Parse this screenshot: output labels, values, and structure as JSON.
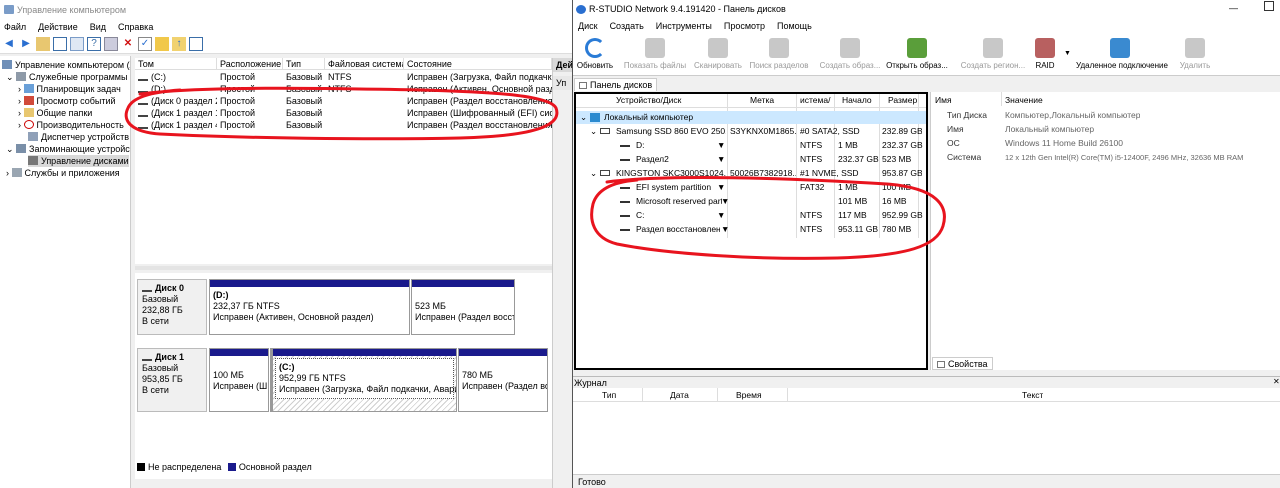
{
  "mmc": {
    "title": "Управление компьютером",
    "menu": [
      "Файл",
      "Действие",
      "Вид",
      "Справка"
    ],
    "tree": [
      {
        "label": "Управление компьютером (л",
        "icon": "computer-icon"
      },
      {
        "label": "Служебные программы",
        "icon": "tools-icon"
      },
      {
        "label": "Планировщик задач",
        "icon": "scheduler-icon"
      },
      {
        "label": "Просмотр событий",
        "icon": "event-viewer-icon"
      },
      {
        "label": "Общие папки",
        "icon": "shared-folder-icon"
      },
      {
        "label": "Производительность",
        "icon": "performance-icon"
      },
      {
        "label": "Диспетчер устройств",
        "icon": "device-manager-icon"
      },
      {
        "label": "Запоминающие устройст",
        "icon": "storage-icon"
      },
      {
        "label": "Управление дисками",
        "icon": "disk-management-icon"
      },
      {
        "label": "Службы и приложения",
        "icon": "services-icon"
      }
    ],
    "volume_columns": [
      "Том",
      "Расположение",
      "Тип",
      "Файловая система",
      "Состояние"
    ],
    "volumes": [
      [
        "(C:)",
        "Простой",
        "Базовый",
        "NTFS",
        "Исправен (Загрузка, Файл подкачки, Ава"
      ],
      [
        "(D:)",
        "Простой",
        "Базовый",
        "NTFS",
        "Исправен (Активен, Основной раздел)"
      ],
      [
        "(Диск 0 раздел 2)",
        "Простой",
        "Базовый",
        "",
        "Исправен (Раздел восстановления)"
      ],
      [
        "(Диск 1 раздел 1)",
        "Простой",
        "Базовый",
        "",
        "Исправен (Шифрованный (EFI) систе"
      ],
      [
        "(Диск 1 раздел 4)",
        "Простой",
        "Базовый",
        "",
        "Исправен (Раздел восстановления)"
      ]
    ],
    "actions_label": "Дей",
    "actions_sub": "Уп",
    "disks": [
      {
        "name": "Диск 0",
        "type": "Базовый",
        "size": "232,88 ГБ",
        "status": "В сети",
        "parts": [
          {
            "title": "(D:)",
            "line1": "232,37 ГБ NTFS",
            "line2": "Исправен (Активен, Основной раздел)"
          },
          {
            "title": "",
            "line1": "523 МБ",
            "line2": "Исправен (Раздел восст"
          }
        ]
      },
      {
        "name": "Диск 1",
        "type": "Базовый",
        "size": "953,85 ГБ",
        "status": "В сети",
        "parts": [
          {
            "title": "",
            "line1": "100 МБ",
            "line2": "Исправен (Ш"
          },
          {
            "title": "",
            "line1": "",
            "line2": ""
          },
          {
            "title": "(C:)",
            "line1": "952,99 ГБ NTFS",
            "line2": "Исправен (Загрузка, Файл подкачки, Аварийн"
          },
          {
            "title": "",
            "line1": "780 МБ",
            "line2": "Исправен (Раздел во"
          }
        ]
      }
    ],
    "legend": [
      "Не распределена",
      "Основной раздел"
    ]
  },
  "rstudio": {
    "title": "R-STUDIO Network 9.4.191420 - Панель дисков",
    "menu": [
      "Диск",
      "Создать",
      "Инструменты",
      "Просмотр",
      "Помощь"
    ],
    "toolbar": [
      "Обновить",
      "Показать файлы",
      "Сканировать",
      "Поиск разделов",
      "Создать образ...",
      "Открыть образ...",
      "Создать регион...",
      "RAID",
      "Удаленное подключение",
      "Удалить"
    ],
    "panel_tab": "Панель дисков",
    "columns": [
      "Устройство/Диск",
      "Метка",
      "истема/",
      "Начало",
      "Размер"
    ],
    "rows": [
      {
        "name": "Локальный компьютер",
        "label": "",
        "fs": "",
        "start": "",
        "size": ""
      },
      {
        "name": "Samsung SSD 860 EVO 250...",
        "label": "S3YKNX0M1865...",
        "fs": "#0 SATA2, SSD",
        "start": "",
        "size": "232.89 GB"
      },
      {
        "name": "D:",
        "label": "",
        "fs": "NTFS",
        "start": "1 MB",
        "size": "232.37 GB"
      },
      {
        "name": "Раздел2",
        "label": "",
        "fs": "NTFS",
        "start": "232.37 GB",
        "size": "523 MB"
      },
      {
        "name": "KINGSTON SKC3000S1024...",
        "label": "50026B7382918...",
        "fs": "#1 NVME, SSD",
        "start": "",
        "size": "953.87 GB"
      },
      {
        "name": "EFI system partition",
        "label": "",
        "fs": "FAT32",
        "start": "1 MB",
        "size": "100 MB"
      },
      {
        "name": "Microsoft reserved parti...",
        "label": "",
        "fs": "",
        "start": "101 MB",
        "size": "16 MB"
      },
      {
        "name": "C:",
        "label": "",
        "fs": "NTFS",
        "start": "117 MB",
        "size": "952.99 GB"
      },
      {
        "name": "Раздел восстановлен...",
        "label": "",
        "fs": "NTFS",
        "start": "953.11 GB",
        "size": "780 MB"
      }
    ],
    "props_columns": [
      "Имя",
      "Значение"
    ],
    "props": [
      [
        "Тип Диска",
        "Компьютер,Локальный компьютер"
      ],
      [
        "Имя",
        "Локальный компьютер"
      ],
      [
        "ОС",
        "Windows 11 Home Build 26100"
      ],
      [
        "Система",
        "12 x 12th Gen Intel(R) Core(TM) i5-12400F, 2496 MHz, 32636 MB RAM"
      ]
    ],
    "props_tab": "Свойства",
    "log_title": "Журнал",
    "log_columns": [
      "Тип",
      "Дата",
      "Время",
      "Текст"
    ],
    "status": "Готово"
  },
  "colors": {
    "annotation": "#e8141e",
    "partition_bar": "#1a1a8c",
    "selection": "#cce8ff",
    "accent": "#0078d7"
  }
}
